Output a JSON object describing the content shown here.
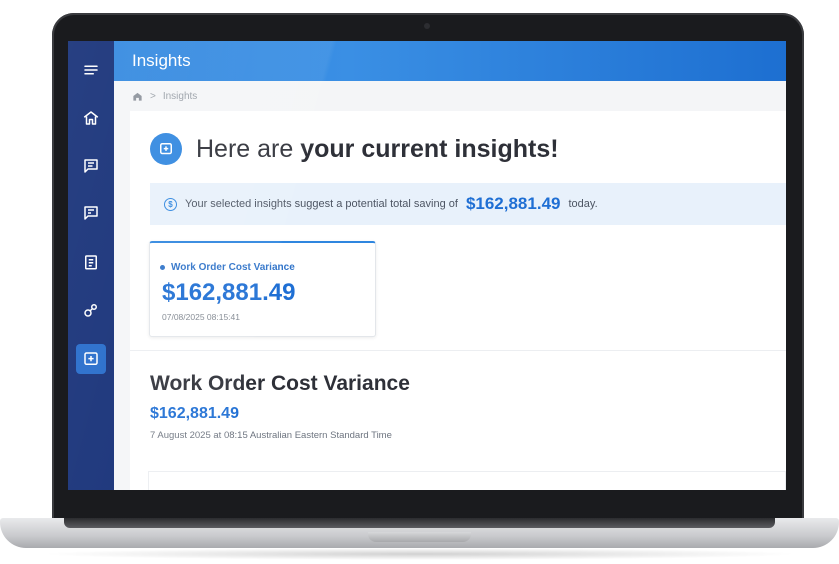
{
  "app": {
    "title": "Insights"
  },
  "breadcrumb": {
    "current": "Insights"
  },
  "sidebar": {
    "items": [
      {
        "icon": "menu-icon",
        "active": false
      },
      {
        "icon": "home-icon",
        "active": false
      },
      {
        "icon": "chat-icon",
        "active": false
      },
      {
        "icon": "chat-edit-icon",
        "active": false
      },
      {
        "icon": "clipboard-icon",
        "active": false
      },
      {
        "icon": "link-icon",
        "active": false
      },
      {
        "icon": "insights-icon",
        "active": true
      }
    ]
  },
  "hero": {
    "title_lead": "Here are ",
    "title_rest": "your current insights!"
  },
  "banner": {
    "text_before": "Your selected insights suggest a potential total saving of",
    "amount": "$162,881.49",
    "text_after": "today."
  },
  "tile": {
    "label": "Work Order Cost Variance",
    "value": "$162,881.49",
    "timestamp": "07/08/2025 08:15:41"
  },
  "section": {
    "title": "Work Order Cost Variance",
    "amount": "$162,881.49",
    "timestamp": "7 August 2025 at 08:15 Australian Eastern Standard Time"
  },
  "colors": {
    "accent": "#2f86df",
    "sidebar": "#0f2a74",
    "amount": "#1f6fd4"
  }
}
